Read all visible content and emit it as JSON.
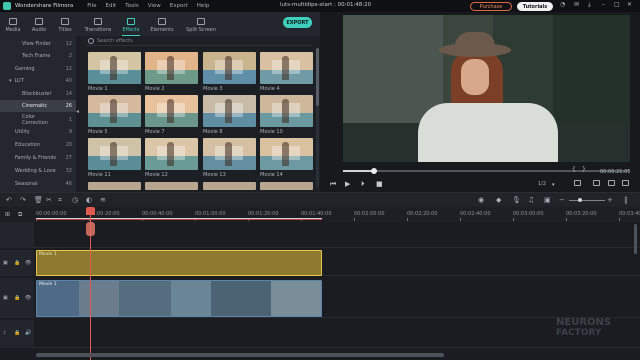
{
  "app": {
    "name": "Wondershare Filmora",
    "menu": [
      "File",
      "Edit",
      "Tools",
      "View",
      "Export",
      "Help"
    ],
    "project": "luts-multidips-start : 00:01:48:20",
    "purchase": "Purchase",
    "tutorials": "Tutorials"
  },
  "tooltabs": [
    {
      "label": "Media",
      "icon": "media-icon"
    },
    {
      "label": "Audio",
      "icon": "audio-icon"
    },
    {
      "label": "Titles",
      "icon": "titles-icon"
    },
    {
      "label": "Transitions",
      "icon": "transitions-icon"
    },
    {
      "label": "Effects",
      "icon": "effects-icon",
      "active": true
    },
    {
      "label": "Elements",
      "icon": "elements-icon"
    },
    {
      "label": "Split Screen",
      "icon": "split-screen-icon"
    }
  ],
  "export_label": "EXPORT",
  "categories": [
    {
      "name": "View Finder",
      "count": "12"
    },
    {
      "name": "Tech Frame",
      "count": "2"
    },
    {
      "name": "Gaming",
      "count": "12"
    },
    {
      "name": "LUT",
      "count": "40"
    },
    {
      "name": "Blockbuster",
      "count": "14"
    },
    {
      "name": "Cinematic",
      "count": "26",
      "active": true
    },
    {
      "name": "Color Correction",
      "count": "1"
    },
    {
      "name": "Utility",
      "count": "9"
    },
    {
      "name": "Education",
      "count": "20"
    },
    {
      "name": "Family & Friends",
      "count": "27"
    },
    {
      "name": "Wedding & Love",
      "count": "32"
    },
    {
      "name": "Seasonal",
      "count": "46"
    }
  ],
  "search": {
    "placeholder": "Search effects"
  },
  "effects": [
    {
      "name": "Movie 1",
      "sky": "#d3c4a4",
      "sea": "#5a8f9a"
    },
    {
      "name": "Movie 2",
      "sky": "#e1b48a",
      "sea": "#6e9a8a"
    },
    {
      "name": "Movie 3",
      "sky": "#c9b48e",
      "sea": "#5f8fa8"
    },
    {
      "name": "Movie 4",
      "sky": "#d8c0a0",
      "sea": "#6f9aa6"
    },
    {
      "name": "Movie 5",
      "sky": "#d4b99e",
      "sea": "#5e9094"
    },
    {
      "name": "Movie 7",
      "sky": "#e7c29c",
      "sea": "#6a968c"
    },
    {
      "name": "Movie 8",
      "sky": "#c8bca8",
      "sea": "#5f8ea2"
    },
    {
      "name": "Movie 10",
      "sky": "#cdb89c",
      "sea": "#6a99a0"
    },
    {
      "name": "Movie 11",
      "sky": "#cfc3a7",
      "sea": "#5b8d98"
    },
    {
      "name": "Movie 12",
      "sky": "#dcc6a8",
      "sea": "#6b9b96"
    },
    {
      "name": "Movie 13",
      "sky": "#d5c0a3",
      "sea": "#638fa0"
    },
    {
      "name": "Movie 14",
      "sky": "#dac1a0",
      "sea": "#6d9aa2"
    }
  ],
  "player": {
    "timecode": "00:00:21:05",
    "page": "1/2",
    "progress": 0.11
  },
  "ruler_ticks": [
    "00:00:00:00",
    "00:00:20:00",
    "00:00:40:00",
    "00:01:00:00",
    "00:01:20:00",
    "00:01:40:00",
    "00:02:00:00",
    "00:02:20:00",
    "00:02:40:00",
    "00:03:00:00",
    "00:03:20:00",
    "00:03:40:00"
  ],
  "clips": {
    "effect": "Movie 1",
    "video_label": "Movie 1"
  },
  "watermark": [
    "NEURONS",
    "FACTORY"
  ]
}
